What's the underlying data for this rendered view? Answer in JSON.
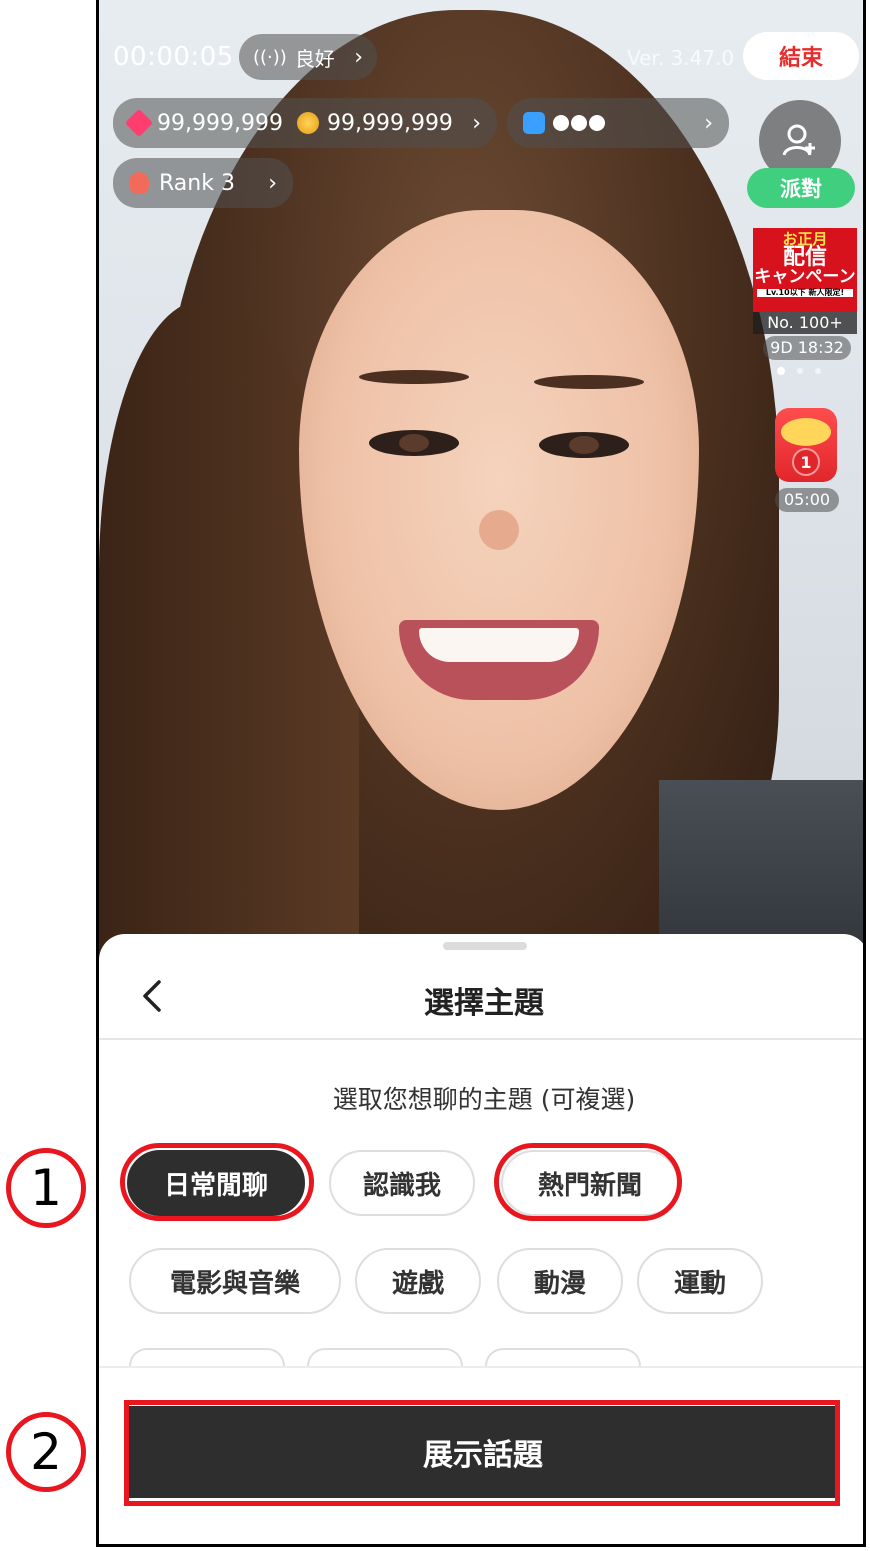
{
  "status": {
    "timer": "00:00:05",
    "network_label": "良好",
    "version": "Ver. 3.47.0",
    "end_label": "結束"
  },
  "stats": {
    "points": "99,999,999",
    "coins": "99,999,999",
    "rank_label": "Rank 3"
  },
  "side": {
    "party_label": "派對",
    "campaign_line1": "お正月",
    "campaign_line2": "配信",
    "campaign_line3": "キャンペーン",
    "campaign_line4": "Lv.10以下 新人限定!",
    "campaign_rank": "No. 100+",
    "campaign_time": "9D 18:32",
    "redpack_count": "1",
    "redpack_time": "05:00"
  },
  "sheet": {
    "title": "選擇主題",
    "subtitle": "選取您想聊的主題 (可複選)",
    "tags": [
      {
        "label": "日常閒聊",
        "selected": true
      },
      {
        "label": "認識我",
        "selected": false
      },
      {
        "label": "熱門新聞",
        "selected": false
      },
      {
        "label": "電影與音樂",
        "selected": false
      },
      {
        "label": "遊戲",
        "selected": false
      },
      {
        "label": "動漫",
        "selected": false
      },
      {
        "label": "運動",
        "selected": false
      }
    ],
    "show_button": "展示話題"
  },
  "annotations": {
    "marker1": "1",
    "marker2": "2"
  },
  "colors": {
    "accent_red": "#e8161e",
    "party_green": "#3fcf7e",
    "selected_tag": "#2e2e2e"
  }
}
